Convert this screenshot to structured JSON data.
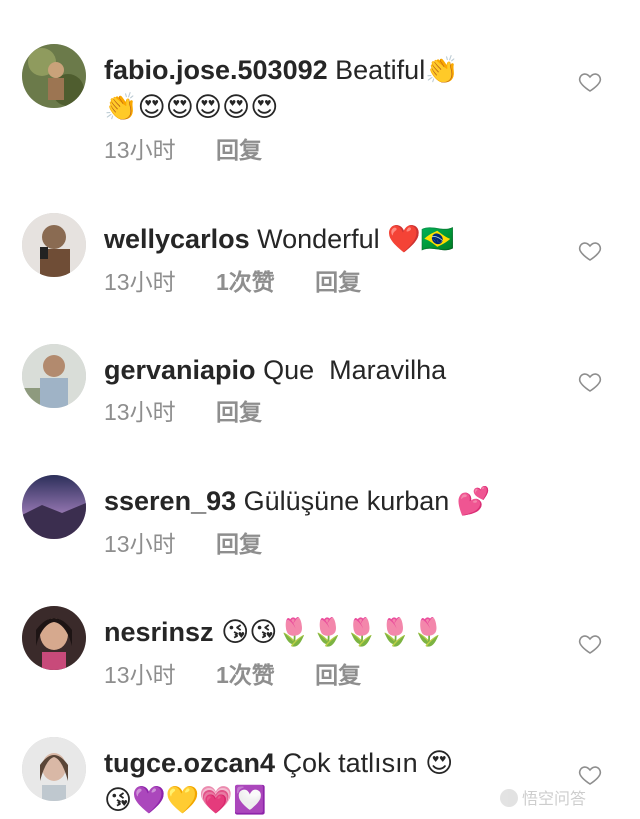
{
  "comments": [
    {
      "username": "fabio.jose.503092",
      "text": "Beatiful",
      "emoji_line1": "👏",
      "emoji_line2": "👏😍😍😍😍😍",
      "time": "13小时",
      "likes": "",
      "reply": "回复",
      "avatar_icon": "avatar-photo"
    },
    {
      "username": "wellycarlos",
      "text": "Wonderful",
      "emoji_line1": "❤️🇧🇷",
      "emoji_line2": "",
      "time": "13小时",
      "likes": "1次赞",
      "reply": "回复",
      "avatar_icon": "avatar-photo"
    },
    {
      "username": "gervaniapio",
      "text": "Que  Maravilha",
      "emoji_line1": "",
      "emoji_line2": "",
      "time": "13小时",
      "likes": "",
      "reply": "回复",
      "avatar_icon": "avatar-photo"
    },
    {
      "username": "sseren_93",
      "text": "Gülüşüne kurban",
      "emoji_line1": "💕",
      "emoji_line2": "",
      "time": "13小时",
      "likes": "",
      "reply": "回复",
      "avatar_icon": "avatar-photo"
    },
    {
      "username": "nesrinsz",
      "text": "",
      "emoji_line1": "😘😘🌷🌷🌷🌷🌷",
      "emoji_line2": "",
      "time": "13小时",
      "likes": "1次赞",
      "reply": "回复",
      "avatar_icon": "avatar-photo"
    },
    {
      "username": "tugce.ozcan4",
      "text": "Çok tatlısın",
      "emoji_line1": "😍",
      "emoji_line2": "😘💜💛💗💟",
      "time": "",
      "likes": "",
      "reply": "",
      "avatar_icon": "avatar-photo"
    }
  ],
  "watermark": "悟空问答",
  "heart_icon": "heart-outline-icon",
  "colors": {
    "text": "#262626",
    "meta": "#8e8e8e",
    "background": "#ffffff"
  }
}
